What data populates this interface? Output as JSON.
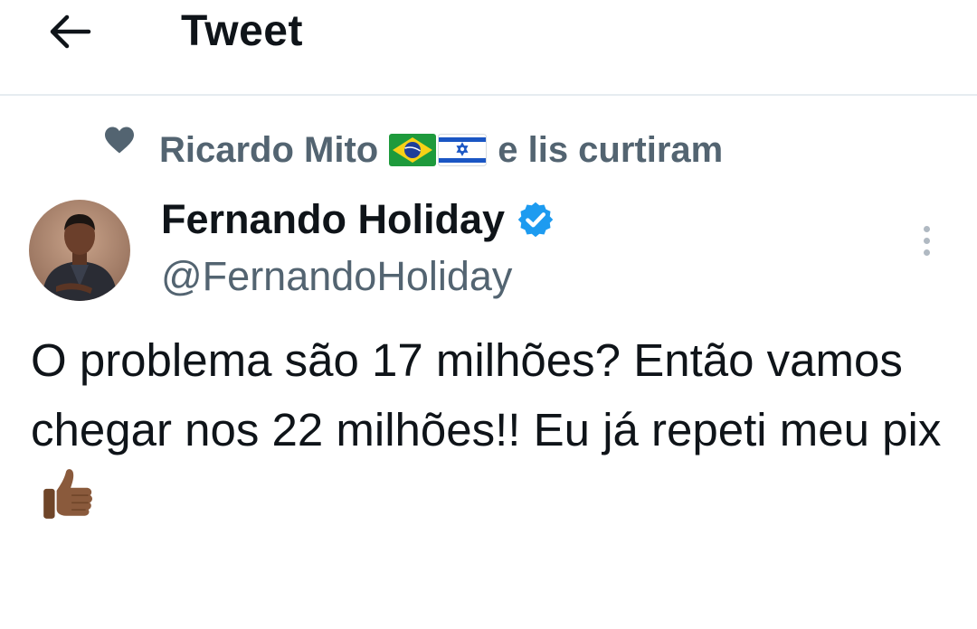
{
  "header": {
    "title": "Tweet",
    "back_icon": "arrow-left-icon"
  },
  "social_context": {
    "icon": "heart-icon",
    "name": "Ricardo Mito",
    "flags": [
      "flag-brazil-icon",
      "flag-israel-icon"
    ],
    "suffix": "e lis curtiram"
  },
  "tweet": {
    "author": {
      "display_name": "Fernando Holiday",
      "handle": "@FernandoHoliday",
      "verified": true
    },
    "text": "O problema são 17 milhões? Então vamos chegar nos 22 milhões!! Eu já repeti meu pix",
    "emoji": "thumbs-up-icon"
  },
  "colors": {
    "text_primary": "#0f1419",
    "text_secondary": "#536471",
    "verified_blue": "#1d9bf0",
    "divider": "#e6ecf0"
  }
}
